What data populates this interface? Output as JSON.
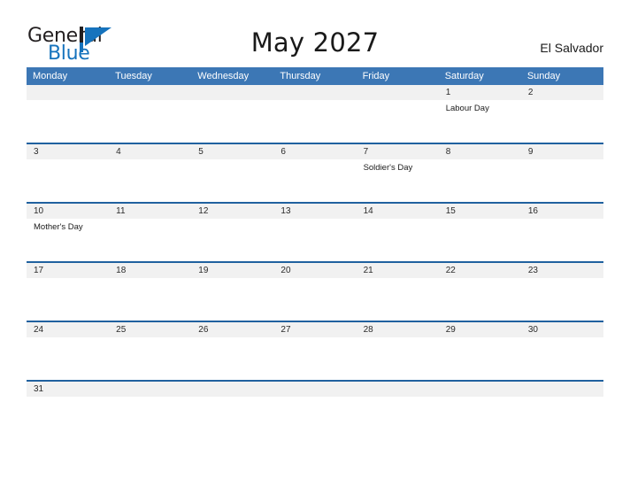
{
  "header": {
    "logo": {
      "word_one": "General",
      "word_two": "Blue",
      "mark_name": "flag-triangle-icon",
      "color_dark": "#231f20",
      "color_blue": "#1673bd"
    },
    "title": "May 2027",
    "country": "El Salvador"
  },
  "calendar": {
    "accent_header_color": "#3c77b5",
    "row_divider_color": "#20619f",
    "daynum_band_color": "#f1f1f1",
    "weekdays": [
      "Monday",
      "Tuesday",
      "Wednesday",
      "Thursday",
      "Friday",
      "Saturday",
      "Sunday"
    ],
    "weeks": [
      {
        "days": [
          {
            "number": "",
            "event": ""
          },
          {
            "number": "",
            "event": ""
          },
          {
            "number": "",
            "event": ""
          },
          {
            "number": "",
            "event": ""
          },
          {
            "number": "",
            "event": ""
          },
          {
            "number": "1",
            "event": "Labour Day"
          },
          {
            "number": "2",
            "event": ""
          }
        ]
      },
      {
        "days": [
          {
            "number": "3",
            "event": ""
          },
          {
            "number": "4",
            "event": ""
          },
          {
            "number": "5",
            "event": ""
          },
          {
            "number": "6",
            "event": ""
          },
          {
            "number": "7",
            "event": "Soldier's Day"
          },
          {
            "number": "8",
            "event": ""
          },
          {
            "number": "9",
            "event": ""
          }
        ]
      },
      {
        "days": [
          {
            "number": "10",
            "event": "Mother's Day"
          },
          {
            "number": "11",
            "event": ""
          },
          {
            "number": "12",
            "event": ""
          },
          {
            "number": "13",
            "event": ""
          },
          {
            "number": "14",
            "event": ""
          },
          {
            "number": "15",
            "event": ""
          },
          {
            "number": "16",
            "event": ""
          }
        ]
      },
      {
        "days": [
          {
            "number": "17",
            "event": ""
          },
          {
            "number": "18",
            "event": ""
          },
          {
            "number": "19",
            "event": ""
          },
          {
            "number": "20",
            "event": ""
          },
          {
            "number": "21",
            "event": ""
          },
          {
            "number": "22",
            "event": ""
          },
          {
            "number": "23",
            "event": ""
          }
        ]
      },
      {
        "days": [
          {
            "number": "24",
            "event": ""
          },
          {
            "number": "25",
            "event": ""
          },
          {
            "number": "26",
            "event": ""
          },
          {
            "number": "27",
            "event": ""
          },
          {
            "number": "28",
            "event": ""
          },
          {
            "number": "29",
            "event": ""
          },
          {
            "number": "30",
            "event": ""
          }
        ]
      },
      {
        "days": [
          {
            "number": "31",
            "event": ""
          },
          {
            "number": "",
            "event": ""
          },
          {
            "number": "",
            "event": ""
          },
          {
            "number": "",
            "event": ""
          },
          {
            "number": "",
            "event": ""
          },
          {
            "number": "",
            "event": ""
          },
          {
            "number": "",
            "event": ""
          }
        ]
      }
    ]
  }
}
